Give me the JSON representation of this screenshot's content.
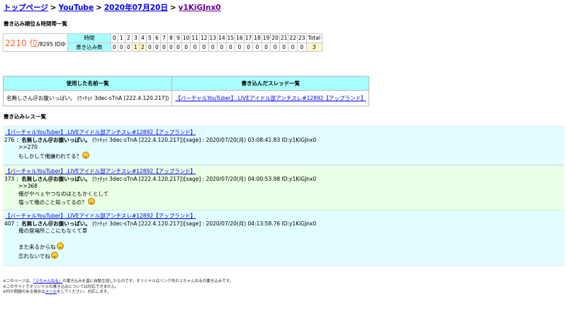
{
  "breadcrumb": {
    "home": "トップページ",
    "sep": ">",
    "category": "YouTube",
    "date": "2020年07月20日",
    "user": "y1KiGJnx0"
  },
  "stats": {
    "heading": "書き込み順位＆時間帯一覧",
    "rank": "2210 位",
    "rank_sub": "/8295 ID中",
    "time_label": "時間",
    "count_label": "書き込み数",
    "hours": [
      "0",
      "1",
      "2",
      "3",
      "4",
      "5",
      "6",
      "7",
      "8",
      "9",
      "10",
      "11",
      "12",
      "13",
      "14",
      "15",
      "16",
      "17",
      "18",
      "19",
      "20",
      "21",
      "22",
      "23",
      "Total"
    ],
    "counts": [
      "0",
      "0",
      "0",
      "1",
      "2",
      "0",
      "0",
      "0",
      "0",
      "0",
      "0",
      "0",
      "0",
      "0",
      "0",
      "0",
      "0",
      "0",
      "0",
      "0",
      "0",
      "0",
      "0",
      "0",
      "3"
    ]
  },
  "lists": {
    "names_header": "使用した名前一覧",
    "threads_header": "書き込んだスレッド一覧",
    "name": "名無しさん＠お腹いっぱい。 (ｳｧﾁｮｲ 3dec-sTnA [222.4.120.217])",
    "thread": "【バーチャルYouTuber】.LIVEアイドル部アンチスレ#12892【アップランド】"
  },
  "posts_heading": "書き込みレス一覧",
  "posts": [
    {
      "thread": "【バーチャルYouTuber】.LIVEアイドル部アンチスレ#12892【アップランド】",
      "num": "276",
      "sep": "：",
      "name": "名無しさん＠お腹いっぱい。",
      "meta": " (ｳｧﾁｮｲ 3dec-sTnA [222.4.120.217])[sage] : 2020/07/20(月) 03:08:41.83 ID:y1KiGJnx0",
      "lines": [
        ">>270",
        "もしかして俺嫌われてる？"
      ]
    },
    {
      "thread": "【バーチャルYouTuber】.LIVEアイドル部アンチスレ#12892【アップランド】",
      "num": "373",
      "sep": "：",
      "name": "名無しさん＠お腹いっぱい。",
      "meta": " (ｳｧﾁｮｲ 3dec-sTnA [222.4.120.217])[sage] : 2020/07/20(月) 04:00:53.98 ID:y1KiGJnx0",
      "lines": [
        ">>368",
        "俺がやべぇやつなのはともかくとして",
        "塩って俺のこと知ってるの？"
      ]
    },
    {
      "thread": "【バーチャルYouTuber】.LIVEアイドル部アンチスレ#12892【アップランド】",
      "num": "407",
      "sep": "：",
      "name": "名無しさん＠お腹いっぱい。",
      "meta": " (ｳｧﾁｮｲ 3dec-sTnA [222.4.120.217])[sage] : 2020/07/20(月) 04:13:58.76 ID:y1KiGJnx0",
      "lines": [
        "俺の居場所ここにもなくて草",
        "",
        "また来るからね",
        "忘れないでね"
      ]
    }
  ],
  "footer": {
    "l1a": "※このページは、",
    "l1link": "『２ちゃんねる』",
    "l1b": "の書き込みを基に自動生成したものです。オリジナルはリンク先の２ちゃんねるの書き込みです。",
    "l2": "※このサイトでオリジナルの書き込みについては対応できません。",
    "l3a": "※何か問題のある場合は",
    "l3link": "メール",
    "l3b": "をしてください。対応します。"
  }
}
